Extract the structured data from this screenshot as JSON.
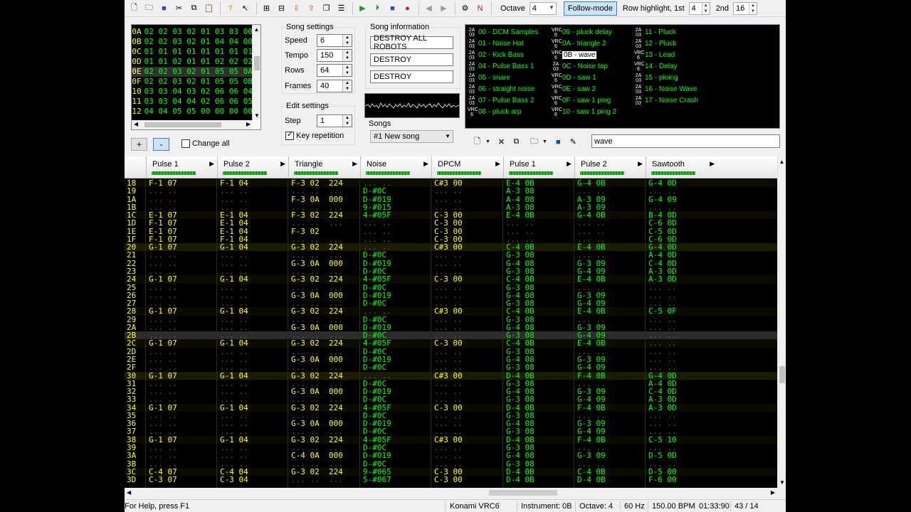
{
  "toolbar": {
    "icons": [
      "new-file-icon",
      "open-folder-icon",
      "save-icon",
      "cut-icon",
      "copy-icon",
      "paste-icon",
      "help-icon",
      "context-help-icon",
      "insert-frame-icon",
      "remove-frame-icon",
      "move-down-icon",
      "move-up-icon",
      "duplicate-frame-icon",
      "module-properties-icon",
      "play-icon",
      "play-loop-icon",
      "stop-icon",
      "record-icon",
      "prev-song-icon",
      "next-song-icon",
      "settings-icon",
      "nsf-export-icon"
    ],
    "octave_label": "Octave",
    "octave_value": "4",
    "follow_mode_label": "Follow-mode",
    "row_highlight_label": "Row highlight, 1st",
    "row_highlight_1st": "4",
    "row_highlight_2nd_label": "2nd",
    "row_highlight_2nd": "16"
  },
  "frames": {
    "rows": [
      {
        "idx": "0A",
        "val": "02 02 03 02 01 03 03 00"
      },
      {
        "idx": "0B",
        "val": "02 02 03 02 01 04 04 00"
      },
      {
        "idx": "0C",
        "val": "01 01 01 01 01 01 01 01"
      },
      {
        "idx": "0D",
        "val": "01 01 02 01 01 02 02 02"
      },
      {
        "idx": "0E",
        "val": "02 02 03 02 01 05 05 0A"
      },
      {
        "idx": "0F",
        "val": "02 02 03 02 01 05 05 0B"
      },
      {
        "idx": "10",
        "val": "03 03 04 03 02 06 06 04"
      },
      {
        "idx": "11",
        "val": "03 03 04 04 02 06 06 05"
      },
      {
        "idx": "12",
        "val": "04 04 05 05 00 00 00 00"
      }
    ],
    "current_index": 4,
    "add_label": "+",
    "remove_label": "-",
    "change_all_label": "Change all"
  },
  "song_settings": {
    "title": "Song settings",
    "speed_label": "Speed",
    "speed": "6",
    "tempo_label": "Tempo",
    "tempo": "150",
    "rows_label": "Rows",
    "rows": "64",
    "frames_label": "Frames",
    "frames": "40"
  },
  "edit_settings": {
    "title": "Edit settings",
    "step_label": "Step",
    "step": "1",
    "key_repetition_label": "Key repetition"
  },
  "song_info": {
    "title": "Song information",
    "name": "DESTROY ALL ROBOTS",
    "artist": "DESTROY",
    "copyright": "DESTROY"
  },
  "songs": {
    "title": "Songs",
    "selected": "#1 New song"
  },
  "instruments": [
    {
      "chip": "2A03",
      "label": "00 - DCM Samples",
      "col": 0,
      "row": 0
    },
    {
      "chip": "2A03",
      "label": "01 - Noise Hat",
      "col": 0,
      "row": 1
    },
    {
      "chip": "2A03",
      "label": "02 - Kick Bass",
      "col": 0,
      "row": 2
    },
    {
      "chip": "2A03",
      "label": "04 - Pulse Bass 1",
      "col": 0,
      "row": 3
    },
    {
      "chip": "2A03",
      "label": "05 - snare",
      "col": 0,
      "row": 4
    },
    {
      "chip": "2A03",
      "label": "06 - straight noise",
      "col": 0,
      "row": 5
    },
    {
      "chip": "2A03",
      "label": "07 - Pulse Bass 2",
      "col": 0,
      "row": 6
    },
    {
      "chip": "VRC6",
      "label": "08 - pluck arp",
      "col": 0,
      "row": 7
    },
    {
      "chip": "VRC6",
      "label": "09 - pluck delay",
      "col": 1,
      "row": 0
    },
    {
      "chip": "VRC6",
      "label": "0A - triangle 2",
      "col": 1,
      "row": 1
    },
    {
      "chip": "VRC6",
      "label": "0B - wave",
      "col": 1,
      "row": 2,
      "selected": true
    },
    {
      "chip": "2A03",
      "label": "0C - Noise tap",
      "col": 1,
      "row": 3
    },
    {
      "chip": "VRC6",
      "label": "0D - saw 1",
      "col": 1,
      "row": 4
    },
    {
      "chip": "VRC6",
      "label": "0E - saw 2",
      "col": 1,
      "row": 5
    },
    {
      "chip": "VRC6",
      "label": "0F - saw 1 ping",
      "col": 1,
      "row": 6
    },
    {
      "chip": "VRC6",
      "label": "10 - saw 1 ping 2",
      "col": 1,
      "row": 7
    },
    {
      "chip": "2A03",
      "label": "11 - Pluck",
      "col": 2,
      "row": 0
    },
    {
      "chip": "2A03",
      "label": "12 - Pluck",
      "col": 2,
      "row": 1
    },
    {
      "chip": "VRC6",
      "label": "13 - Lead",
      "col": 2,
      "row": 2
    },
    {
      "chip": "VRC6",
      "label": "14 - Delay",
      "col": 2,
      "row": 3
    },
    {
      "chip": "2A03",
      "label": "15 - ploing",
      "col": 2,
      "row": 4
    },
    {
      "chip": "2A03",
      "label": "16 - Noise Wave",
      "col": 2,
      "row": 5
    },
    {
      "chip": "2A03",
      "label": "17 - Noise Crash",
      "col": 2,
      "row": 6
    }
  ],
  "instrument_name": "wave",
  "channels": [
    "Pulse 1",
    "Pulse 2",
    "Triangle",
    "Noise",
    "DPCM",
    "Pulse 1",
    "Pulse 2",
    "Sawtooth"
  ],
  "pattern_rows": [
    {
      "n": "18",
      "c": [
        "F-1 07",
        "F-1 04",
        "F-3 02  224",
        "",
        "C#3 00",
        "E-4 0B",
        "G-4 0B",
        "G-4 0D"
      ]
    },
    {
      "n": "19",
      "c": [
        "",
        "",
        "",
        "D-#0C",
        "",
        "A-3 08",
        "",
        ""
      ]
    },
    {
      "n": "1A",
      "c": [
        "",
        "",
        "F-3 0A  000",
        "D-#019",
        "",
        "A-4 08",
        "A-3 09",
        "G-4 09"
      ]
    },
    {
      "n": "1B",
      "c": [
        "",
        "",
        "",
        "9-#015",
        "",
        "A-3 08",
        "A-3 09",
        ""
      ]
    },
    {
      "n": "1C",
      "c": [
        "E-1 07",
        "E-1 04",
        "F-3 02  224",
        "4-#05F",
        "C-3 00",
        "E-4 0B",
        "G-4 0B",
        "B-4 0D"
      ]
    },
    {
      "n": "1D",
      "c": [
        "F-1 07",
        "E-1 04",
        "",
        "",
        "C-3 00",
        "",
        "",
        "C-6 0D"
      ]
    },
    {
      "n": "1E",
      "c": [
        "E-1 07",
        "E-1 04",
        "F-3 02",
        "",
        "C-3 00",
        "",
        "",
        "C-5 0D"
      ]
    },
    {
      "n": "1F",
      "c": [
        "F-1 07",
        "F-1 04",
        "",
        "",
        "C-3 00",
        "",
        "",
        "C-6 0D"
      ]
    },
    {
      "n": "20",
      "c": [
        "G-1 07",
        "G-1 04",
        "G-3 02  224",
        "",
        "C#3 00",
        "C-4 0B",
        "E-4 0B",
        "G-4 0D"
      ]
    },
    {
      "n": "21",
      "c": [
        "",
        "",
        "",
        "D-#0C",
        "",
        "G-3 08",
        "",
        "A-4 0D"
      ]
    },
    {
      "n": "22",
      "c": [
        "",
        "",
        "G-3 0A  000",
        "D-#019",
        "",
        "G-4 08",
        "G-3 09",
        "C-4 0D"
      ]
    },
    {
      "n": "23",
      "c": [
        "",
        "",
        "",
        "D-#0C",
        "",
        "G-3 08",
        "G-4 09",
        "A-3 0D"
      ]
    },
    {
      "n": "24",
      "c": [
        "G-1 07",
        "G-1 04",
        "G-3 02  224",
        "4-#05F",
        "C-3 00",
        "C-4 0B",
        "E-4 0B",
        "A-3 0D"
      ]
    },
    {
      "n": "25",
      "c": [
        "",
        "",
        "",
        "D-#0C",
        "",
        "G-3 08",
        "",
        ""
      ]
    },
    {
      "n": "26",
      "c": [
        "",
        "",
        "G-3 0A  000",
        "D-#019",
        "",
        "G-4 08",
        "G-3 09",
        ""
      ]
    },
    {
      "n": "27",
      "c": [
        "",
        "",
        "",
        "D-#0C",
        "",
        "G-3 08",
        "G-4 09",
        ""
      ]
    },
    {
      "n": "28",
      "c": [
        "G-1 07",
        "G-1 04",
        "G-3 02  224",
        "",
        "C#3 00",
        "C-4 0B",
        "E-4 0B",
        "C-5 0F"
      ]
    },
    {
      "n": "29",
      "c": [
        "",
        "",
        "",
        "D-#0C",
        "",
        "G-3 08",
        "",
        ""
      ]
    },
    {
      "n": "2A",
      "c": [
        "",
        "",
        "G-3 0A  000",
        "D-#019",
        "",
        "G-4 08",
        "G-3 09",
        ""
      ]
    },
    {
      "n": "2B",
      "c": [
        "",
        "",
        "",
        "D-#0C",
        "",
        "G-3 08",
        "G-4 09",
        ""
      ]
    },
    {
      "n": "2C",
      "c": [
        "G-1 07",
        "G-1 04",
        "G-3 02  224",
        "4-#05F",
        "C-3 00",
        "C-4 0B",
        "E-4 0B",
        ""
      ]
    },
    {
      "n": "2D",
      "c": [
        "",
        "",
        "",
        "D-#0C",
        "",
        "G-3 08",
        "",
        ""
      ]
    },
    {
      "n": "2E",
      "c": [
        "",
        "",
        "G-3 0A  000",
        "D-#019",
        "",
        "G-4 08",
        "G-3 09",
        ""
      ]
    },
    {
      "n": "2F",
      "c": [
        "",
        "",
        "",
        "D-#0C",
        "",
        "G-3 08",
        "G-4 09",
        ""
      ]
    },
    {
      "n": "30",
      "c": [
        "G-1 07",
        "G-1 04",
        "G-3 02  224",
        "",
        "C#3 00",
        "D-4 0B",
        "F-4 0B",
        "G-4 0D"
      ]
    },
    {
      "n": "31",
      "c": [
        "",
        "",
        "",
        "D-#0C",
        "",
        "G-3 08",
        "",
        "A-4 0D"
      ]
    },
    {
      "n": "32",
      "c": [
        "",
        "",
        "G-3 0A  000",
        "D-#019",
        "",
        "G-4 08",
        "G-3 09",
        "C-4 0D"
      ]
    },
    {
      "n": "33",
      "c": [
        "",
        "",
        "",
        "D-#0C",
        "",
        "G-3 08",
        "G-4 09",
        "A-3 0D"
      ]
    },
    {
      "n": "34",
      "c": [
        "G-1 07",
        "G-1 04",
        "G-3 02  224",
        "4-#05F",
        "C-3 00",
        "D-4 0B",
        "F-4 0B",
        "A-3 0D"
      ]
    },
    {
      "n": "35",
      "c": [
        "",
        "",
        "",
        "D-#0C",
        "",
        "G-3 08",
        "",
        ""
      ]
    },
    {
      "n": "36",
      "c": [
        "",
        "",
        "G-3 0A  000",
        "D-#019",
        "",
        "G-4 08",
        "G-3 09",
        ""
      ]
    },
    {
      "n": "37",
      "c": [
        "",
        "",
        "",
        "D-#0C",
        "",
        "G-3 08",
        "G-4 09",
        ""
      ]
    },
    {
      "n": "38",
      "c": [
        "G-1 07",
        "G-1 04",
        "G-3 02  224",
        "4-#05F",
        "C#3 00",
        "D-4 0B",
        "F-4 0B",
        "C-5 10"
      ]
    },
    {
      "n": "39",
      "c": [
        "",
        "",
        "",
        "D-#0C",
        "",
        "G-3 08",
        "",
        ""
      ]
    },
    {
      "n": "3A",
      "c": [
        "",
        "",
        "C-4 0A  000",
        "D-#019",
        "",
        "G-4 08",
        "G-3 09",
        "D-5 0D"
      ]
    },
    {
      "n": "3B",
      "c": [
        "",
        "",
        "",
        "D-#0C",
        "",
        "G-3 08",
        "",
        ""
      ]
    },
    {
      "n": "3C",
      "c": [
        "C-4 07",
        "C-4 04",
        "G-3 02  224",
        "9-#065",
        "C-3 00",
        "D-4 0B",
        "C-4 0B",
        "D-5 00"
      ]
    },
    {
      "n": "3D",
      "c": [
        "C-3 07",
        "C-3 04",
        "",
        "5-#067",
        "C-3 00",
        "D-4 0B",
        "D-4 0B",
        "F-6 00"
      ]
    }
  ],
  "cursor_row": "2B",
  "status": {
    "help": "For Help, press F1",
    "chip": "Konami VRC6",
    "instrument": "Instrument: 0B",
    "octave": "Octave: 4",
    "rate": "60 Hz",
    "bpm": "150.00 BPM",
    "time": "01:33:90",
    "position": "43 / 14"
  },
  "colors": {
    "note": "#ffff00",
    "effect": "#00ff00",
    "row_number": "#ffff00",
    "empty": "#5a5a5a",
    "background": "#000000",
    "highlight": "#1c1c00"
  }
}
